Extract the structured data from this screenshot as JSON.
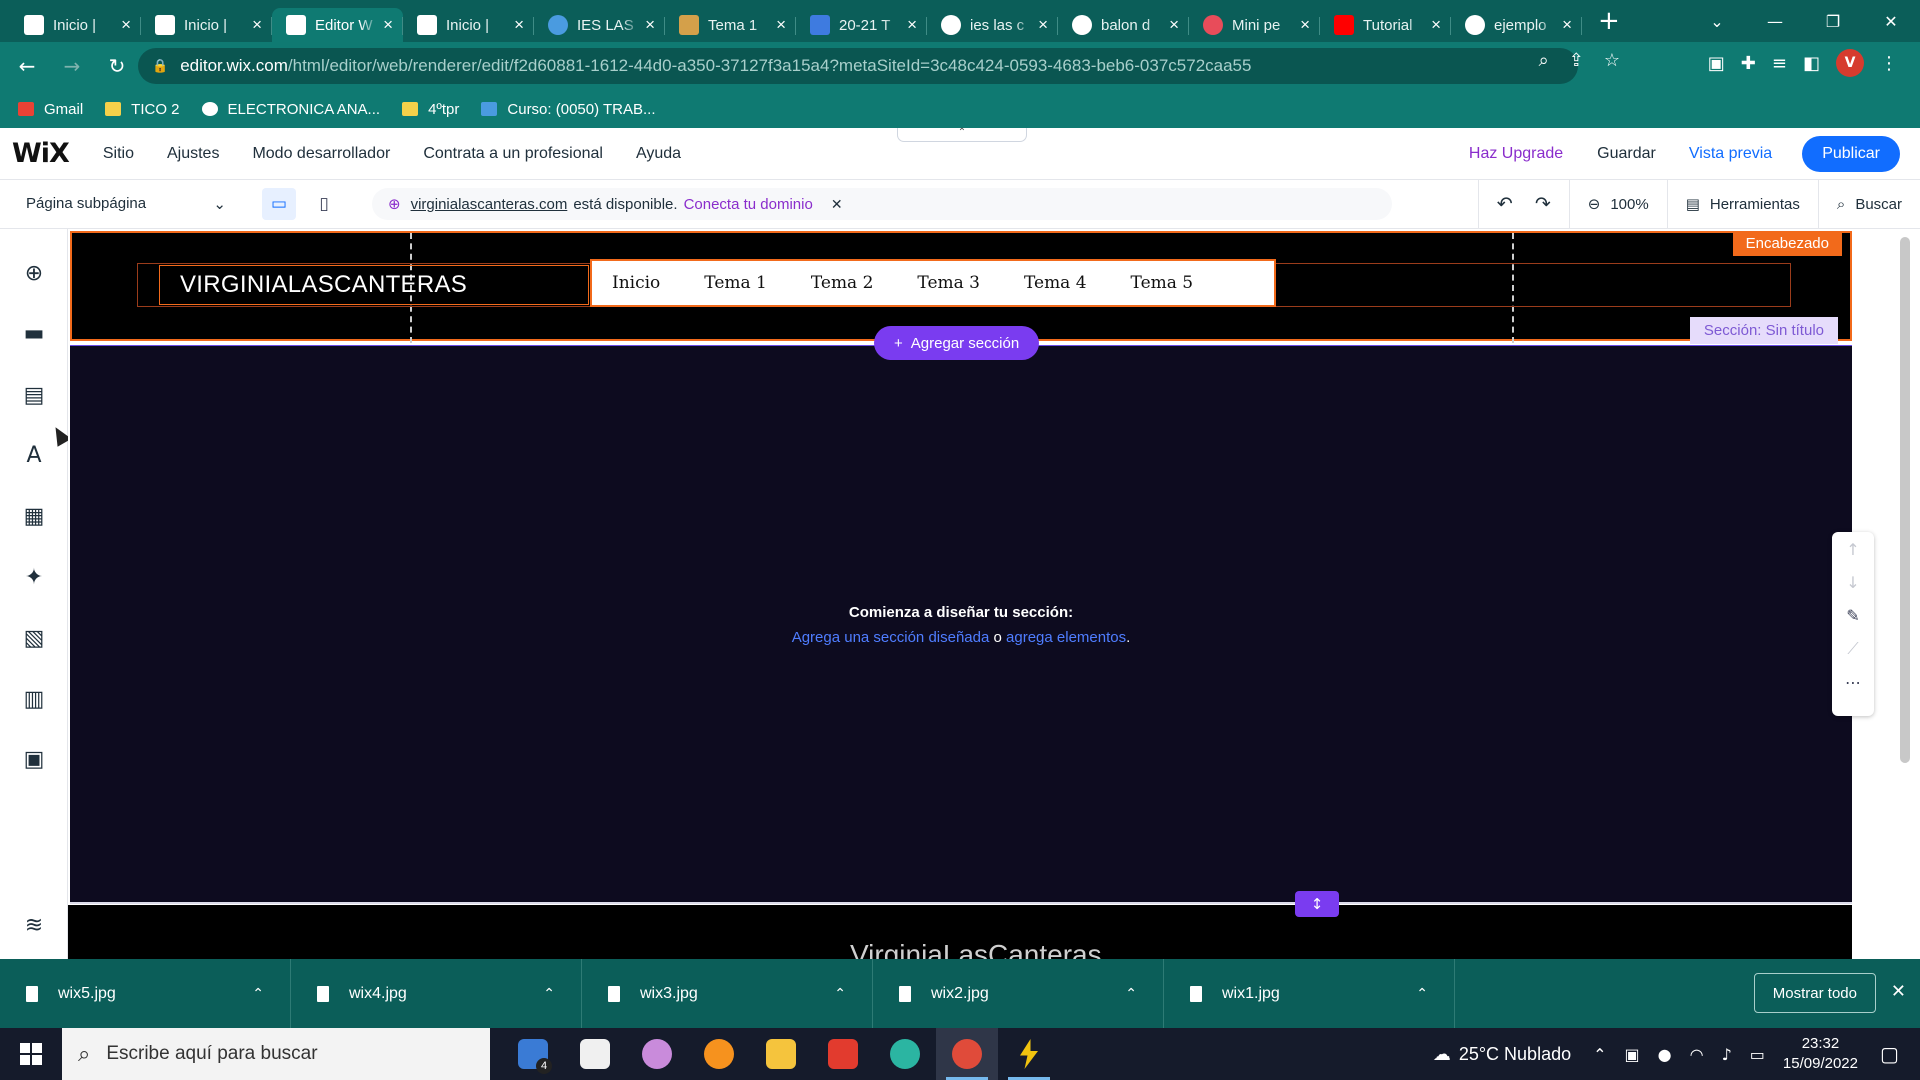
{
  "browser": {
    "tabs": [
      {
        "title": "Inicio | ",
        "icon": "wix-icon",
        "active": false
      },
      {
        "title": "Inicio | ",
        "icon": "wix-icon",
        "active": false
      },
      {
        "title": "Editor W",
        "icon": "wix-icon",
        "active": true
      },
      {
        "title": "Inicio | ",
        "icon": "wix-icon",
        "active": false
      },
      {
        "title": "IES LAS",
        "icon": "globe-icon",
        "active": false
      },
      {
        "title": "Tema 1",
        "icon": "colorful-icon",
        "active": false
      },
      {
        "title": "20-21 T",
        "icon": "school-icon",
        "active": false
      },
      {
        "title": "ies las c",
        "icon": "google-icon",
        "active": false
      },
      {
        "title": "balon d",
        "icon": "google-icon",
        "active": false
      },
      {
        "title": "Mini pe",
        "icon": "red-circle-icon",
        "active": false
      },
      {
        "title": "Tutorial",
        "icon": "youtube-icon",
        "active": false
      },
      {
        "title": "ejemplo",
        "icon": "google-icon",
        "active": false
      }
    ],
    "url_host": "editor.wix.com",
    "url_path": "/html/editor/web/renderer/edit/f2d60881-1612-44d0-a350-37127f3a15a4?metaSiteId=3c48c424-0593-4683-beb6-037c572caa55",
    "profile_initial": "V",
    "bookmarks": [
      "Gmail",
      "TICO 2",
      "ELECTRONICA ANA...",
      "4ºtpr",
      "Curso: (0050) TRAB..."
    ]
  },
  "wix": {
    "logo": "WiX",
    "menu": [
      "Sitio",
      "Ajustes",
      "Modo desarrollador",
      "Contrata a un profesional",
      "Ayuda"
    ],
    "upgrade": "Haz Upgrade",
    "save": "Guardar",
    "preview": "Vista previa",
    "publish": "Publicar",
    "page_selector": "Página subpágina",
    "domain_name": "virginialascanteras.com",
    "domain_available": "está disponible.",
    "domain_connect": "Conecta tu dominio",
    "zoom": "100%",
    "tools": "Herramientas",
    "search": "Buscar"
  },
  "canvas": {
    "header_tag": "Encabezado",
    "site_title": "VIRGINIALASCANTERAS",
    "nav_items": [
      "Inicio",
      "Tema 1",
      "Tema 2",
      "Tema 3",
      "Tema 4",
      "Tema 5"
    ],
    "section_tag": "Sección: Sin título",
    "add_section": "Agregar sección",
    "prompt_title": "Comienza a diseñar tu sección:",
    "prompt_link1": "Agrega una sección diseñada",
    "prompt_or": " o ",
    "prompt_link2": "agrega elementos",
    "prompt_end": ".",
    "footer_text": "VirginiaLasCanteras"
  },
  "downloads": {
    "files": [
      "wix5.jpg",
      "wix4.jpg",
      "wix3.jpg",
      "wix2.jpg",
      "wix1.jpg"
    ],
    "show_all": "Mostrar todo"
  },
  "taskbar": {
    "search_placeholder": "Escribe aquí para buscar",
    "mail_badge": "4",
    "weather": "25°C  Nublado",
    "time": "23:32",
    "date": "15/09/2022"
  },
  "colors": {
    "chrome_dark": "#0b5e59",
    "chrome": "#0f7a72",
    "wix_blue": "#116dff",
    "wix_purple": "#7a3cf0",
    "header_orange": "#f26a1b"
  }
}
